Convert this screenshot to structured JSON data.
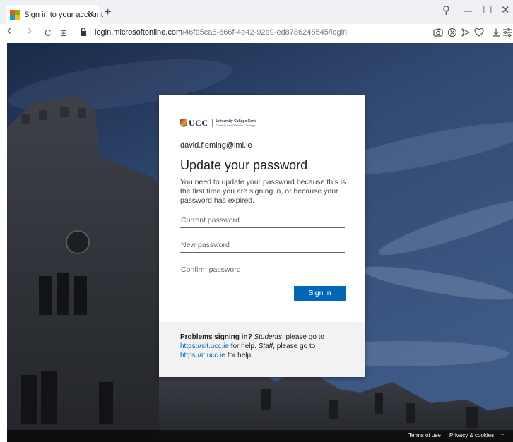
{
  "tab": {
    "title": "Sign in to your account",
    "close": "✕",
    "new": "+"
  },
  "window": {
    "search": "⚲",
    "minimize": "—",
    "maximize": "☐",
    "close": "✕"
  },
  "nav": {
    "back": "‹",
    "forward": "›",
    "reload": "C",
    "grid": "⊞"
  },
  "address": {
    "host": "login.microsoftonline.com",
    "path": "/46fe5ca5-866f-4e42-92e9-ed8786245545/login"
  },
  "logo": {
    "abbr": "UCC",
    "name": "University College Cork",
    "name_irish": "Coláiste na hOllscoile Corcaigh"
  },
  "login": {
    "account": "david.fleming@imi.ie",
    "heading": "Update your password",
    "description": "You need to update your password because this is the first time you are signing in, or because your password has expired.",
    "current_placeholder": "Current password",
    "new_placeholder": "New password",
    "confirm_placeholder": "Confirm password",
    "signin_label": "Sign in"
  },
  "help": {
    "bold": "Problems signing in?",
    "students": "Students",
    "text1": ", please go to",
    "link1": "https://sit.ucc.ie",
    "text2": " for help. ",
    "staff": "Staff",
    "text3": ", please go to",
    "link2": "https://it.ucc.ie",
    "text4": " for help."
  },
  "footer": {
    "terms": "Terms of use",
    "privacy": "Privacy & cookies",
    "more": "···"
  },
  "colors": {
    "accent": "#0067b8",
    "tab_bg": "#eef0f3"
  }
}
